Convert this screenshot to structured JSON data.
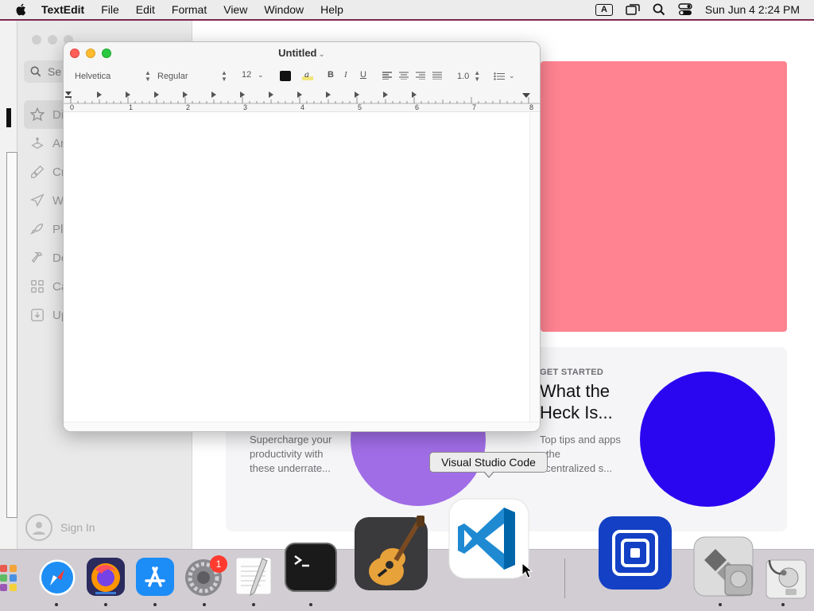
{
  "menubar": {
    "app_name": "TextEdit",
    "items": [
      "File",
      "Edit",
      "Format",
      "View",
      "Window",
      "Help"
    ],
    "input_indicator": "A",
    "clock": "Sun Jun 4  2:24 PM",
    "icons": [
      "apple-icon",
      "keyboard-input-icon",
      "screen-mirroring-icon",
      "spotlight-search-icon",
      "control-center-icon"
    ]
  },
  "store": {
    "search_placeholder": "Se",
    "nav": [
      {
        "label": "Di",
        "icon": "star-icon"
      },
      {
        "label": "Ar",
        "icon": "arcade-icon"
      },
      {
        "label": "Cr",
        "icon": "create-brush-icon"
      },
      {
        "label": "W",
        "icon": "work-paperplane-icon"
      },
      {
        "label": "Pl",
        "icon": "play-rocket-icon"
      },
      {
        "label": "De",
        "icon": "develop-hammer-icon"
      },
      {
        "label": "Ca",
        "icon": "categories-grid-icon"
      },
      {
        "label": "Up",
        "icon": "updates-icon"
      }
    ],
    "sign_in": "Sign In",
    "card_a_text": "Supercharge your productivity with these underrate...",
    "card_b_kicker": "GET STARTED",
    "card_b_title": "What the Heck Is...",
    "card_b_text": "Top tips and apps r the ecentralized s...",
    "colors": {
      "pink": "#ff8391",
      "purple": "#a06de6",
      "blue": "#2a06f0"
    }
  },
  "textedit": {
    "title": "Untitled",
    "font_family": "Helvetica",
    "font_style": "Regular",
    "font_size": "12",
    "bold": "B",
    "italic": "I",
    "underline": "U",
    "line_spacing": "1.0",
    "ruler_numbers": [
      "0",
      "1",
      "2",
      "3",
      "4",
      "5",
      "6",
      "7",
      "8"
    ]
  },
  "tooltip": {
    "text": "Visual Studio Code"
  },
  "dock": {
    "items": [
      "Launchpad",
      "Safari",
      "Firefox",
      "App Store",
      "System Preferences",
      "TextEdit",
      "Terminal",
      "GarageBand",
      "Visual Studio Code",
      "Remote Desktop",
      "Boot Camp Assistant",
      "Disk Utility"
    ],
    "system_preferences_badge": "1"
  }
}
